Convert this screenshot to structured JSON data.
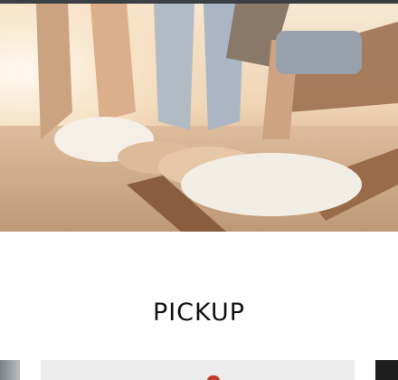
{
  "pickup": {
    "heading": "PICKUP"
  },
  "hero": {
    "icon": "hero-photo"
  },
  "colors": {
    "top_bar": "#3a3f44",
    "heading_text": "#111111",
    "slide_accent": "#c0392b"
  }
}
